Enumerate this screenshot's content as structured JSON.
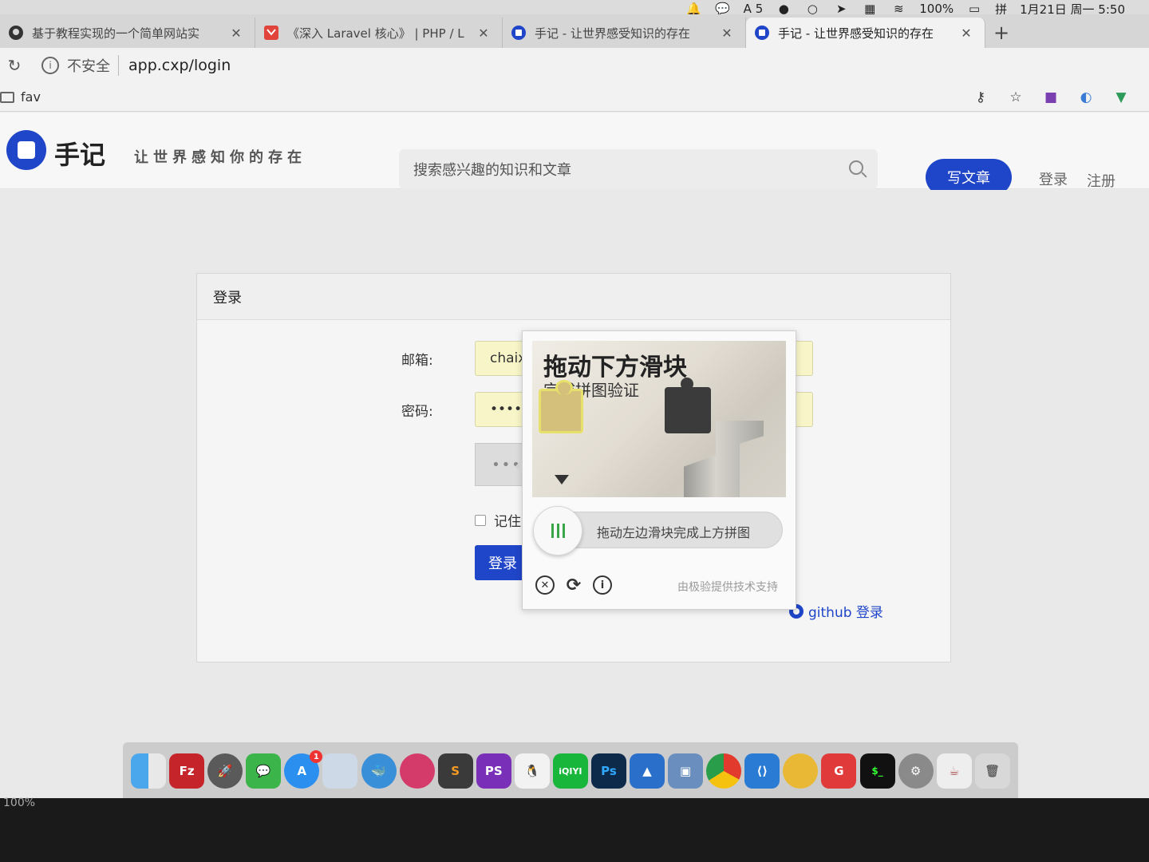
{
  "menubar": {
    "adobe_count": "5",
    "battery": "100%",
    "input_method": "拼",
    "datetime": "1月21日 周一  5:50"
  },
  "tabs": [
    {
      "title": "基于教程实现的一个简单网站实",
      "icon": "github-icon"
    },
    {
      "title": "《深入 Laravel 核心》 | PHP / L",
      "icon": "laravel-icon"
    },
    {
      "title": "手记 - 让世界感受知识的存在",
      "icon": "site-icon"
    },
    {
      "title": "手记 - 让世界感受知识的存在",
      "icon": "site-icon",
      "active": true
    }
  ],
  "address": {
    "security": "不安全",
    "url": "app.cxp/login"
  },
  "bookmarks": {
    "folder": "fav"
  },
  "site": {
    "logo_text": "手记",
    "slogan": "让世界感知你的存在",
    "search_placeholder": "搜索感兴趣的知识和文章",
    "write_button": "写文章",
    "login": "登录",
    "register": "注册"
  },
  "login_card": {
    "title": "登录",
    "email_label": "邮箱:",
    "email_value": "chaix",
    "password_label": "密码:",
    "password_value": "••••",
    "captcha_dots": "•••",
    "remember_label": "记住",
    "submit": "登录",
    "github_login": "github 登录"
  },
  "geetest": {
    "title": "拖动下方滑块",
    "subtitle": "完成拼图验证",
    "slider_hint": "拖动左边滑块完成上方拼图",
    "credit": "由极验提供技术支持"
  },
  "dock": {
    "apps": [
      "finder-icon",
      "filezilla-icon",
      "launchpad-icon",
      "wechat-icon",
      "app-store-icon",
      "preview-icon",
      "docker-icon",
      "ball-icon",
      "sublime-icon",
      "phpstorm-icon",
      "qq-icon",
      "iqiyi-icon",
      "photoshop-icon",
      "shark-icon",
      "virtualbox-icon",
      "chrome-icon",
      "vscode-icon",
      "cyberduck-icon",
      "gitkraken-icon",
      "terminal-icon",
      "system-preferences-icon",
      "teapot-icon",
      "trash-icon"
    ],
    "labels": {
      "filezilla": "Fz",
      "phpstorm": "PS",
      "iqiyi": "iQIYI",
      "photoshop": "Ps",
      "terminal": "$_",
      "app_store_badge": "1"
    }
  },
  "bezel": {
    "zoom": "100%"
  }
}
